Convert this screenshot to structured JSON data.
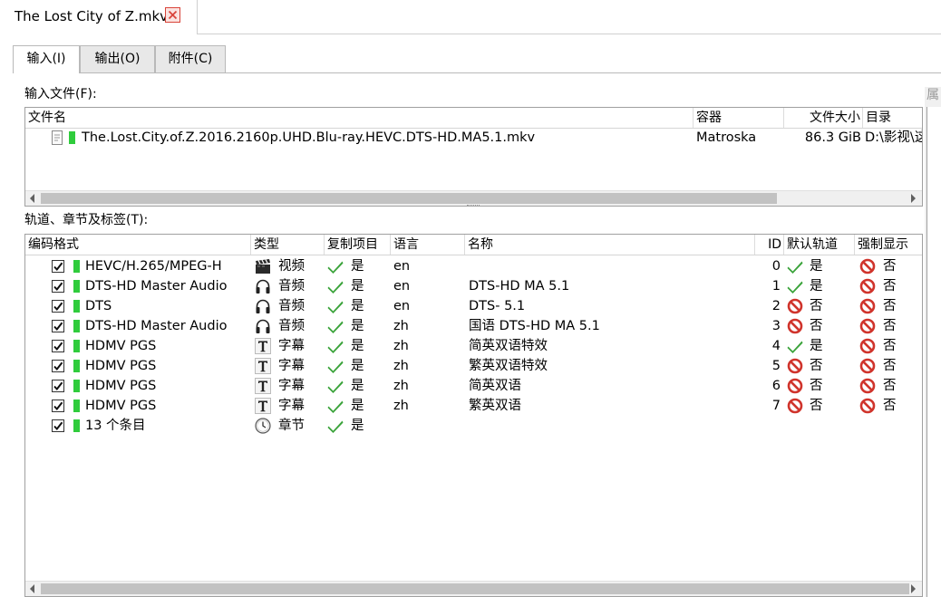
{
  "window": {
    "tab_title": "The Lost City of Z.mkv"
  },
  "sub_tabs": [
    {
      "label": "输入(I)"
    },
    {
      "label": "输出(O)"
    },
    {
      "label": "附件(C)"
    }
  ],
  "input_files": {
    "label": "输入文件(F):",
    "columns": [
      "文件名",
      "容器",
      "文件大小",
      "目录"
    ],
    "rows": [
      {
        "name": "The.Lost.City.of.Z.2016.2160p.UHD.Blu-ray.HEVC.DTS-HD.MA5.1.mkv",
        "container": "Matroska",
        "size": "86.3 GiB",
        "dir": "D:\\影视\\这"
      }
    ]
  },
  "right_panel": {
    "label": "属"
  },
  "tracks": {
    "label": "轨道、章节及标签(T):",
    "columns": [
      "编码格式",
      "类型",
      "复制项目",
      "语言",
      "名称",
      "ID",
      "默认轨道",
      "强制显示"
    ],
    "rows": [
      {
        "codec": "HEVC/H.265/MPEG-H",
        "type_icon": "video-icon",
        "type": "视频",
        "copy": "是",
        "lang": "en",
        "name": "",
        "id": "0",
        "default_icon": "check-icon",
        "default": "是",
        "forced": "否"
      },
      {
        "codec": "DTS-HD Master Audio",
        "type_icon": "headphones-icon",
        "type": "音频",
        "copy": "是",
        "lang": "en",
        "name": "DTS-HD MA 5.1",
        "id": "1",
        "default_icon": "check-icon",
        "default": "是",
        "forced": "否"
      },
      {
        "codec": "DTS",
        "type_icon": "headphones-icon",
        "type": "音频",
        "copy": "是",
        "lang": "en",
        "name": "DTS- 5.1",
        "id": "2",
        "default_icon": "no-icon",
        "default": "否",
        "forced": "否"
      },
      {
        "codec": "DTS-HD Master Audio",
        "type_icon": "headphones-icon",
        "type": "音频",
        "copy": "是",
        "lang": "zh",
        "name": "国语 DTS-HD MA 5.1",
        "id": "3",
        "default_icon": "no-icon",
        "default": "否",
        "forced": "否"
      },
      {
        "codec": "HDMV PGS",
        "type_icon": "text-icon",
        "type": "字幕",
        "copy": "是",
        "lang": "zh",
        "name": "简英双语特效",
        "id": "4",
        "default_icon": "check-icon",
        "default": "是",
        "forced": "否"
      },
      {
        "codec": "HDMV PGS",
        "type_icon": "text-icon",
        "type": "字幕",
        "copy": "是",
        "lang": "zh",
        "name": "繁英双语特效",
        "id": "5",
        "default_icon": "no-icon",
        "default": "否",
        "forced": "否"
      },
      {
        "codec": "HDMV PGS",
        "type_icon": "text-icon",
        "type": "字幕",
        "copy": "是",
        "lang": "zh",
        "name": "简英双语",
        "id": "6",
        "default_icon": "no-icon",
        "default": "否",
        "forced": "否"
      },
      {
        "codec": "HDMV PGS",
        "type_icon": "text-icon",
        "type": "字幕",
        "copy": "是",
        "lang": "zh",
        "name": "繁英双语",
        "id": "7",
        "default_icon": "no-icon",
        "default": "否",
        "forced": "否"
      },
      {
        "codec": "13 个条目",
        "type_icon": "clock-icon",
        "type": "章节",
        "copy": "是",
        "lang": "",
        "name": "",
        "id": "",
        "default_icon": "",
        "default": "",
        "forced": ""
      }
    ]
  },
  "colors": {
    "accent_green": "#2fcc3c",
    "check_green": "#3aa33a",
    "no_red": "#d0342c"
  }
}
